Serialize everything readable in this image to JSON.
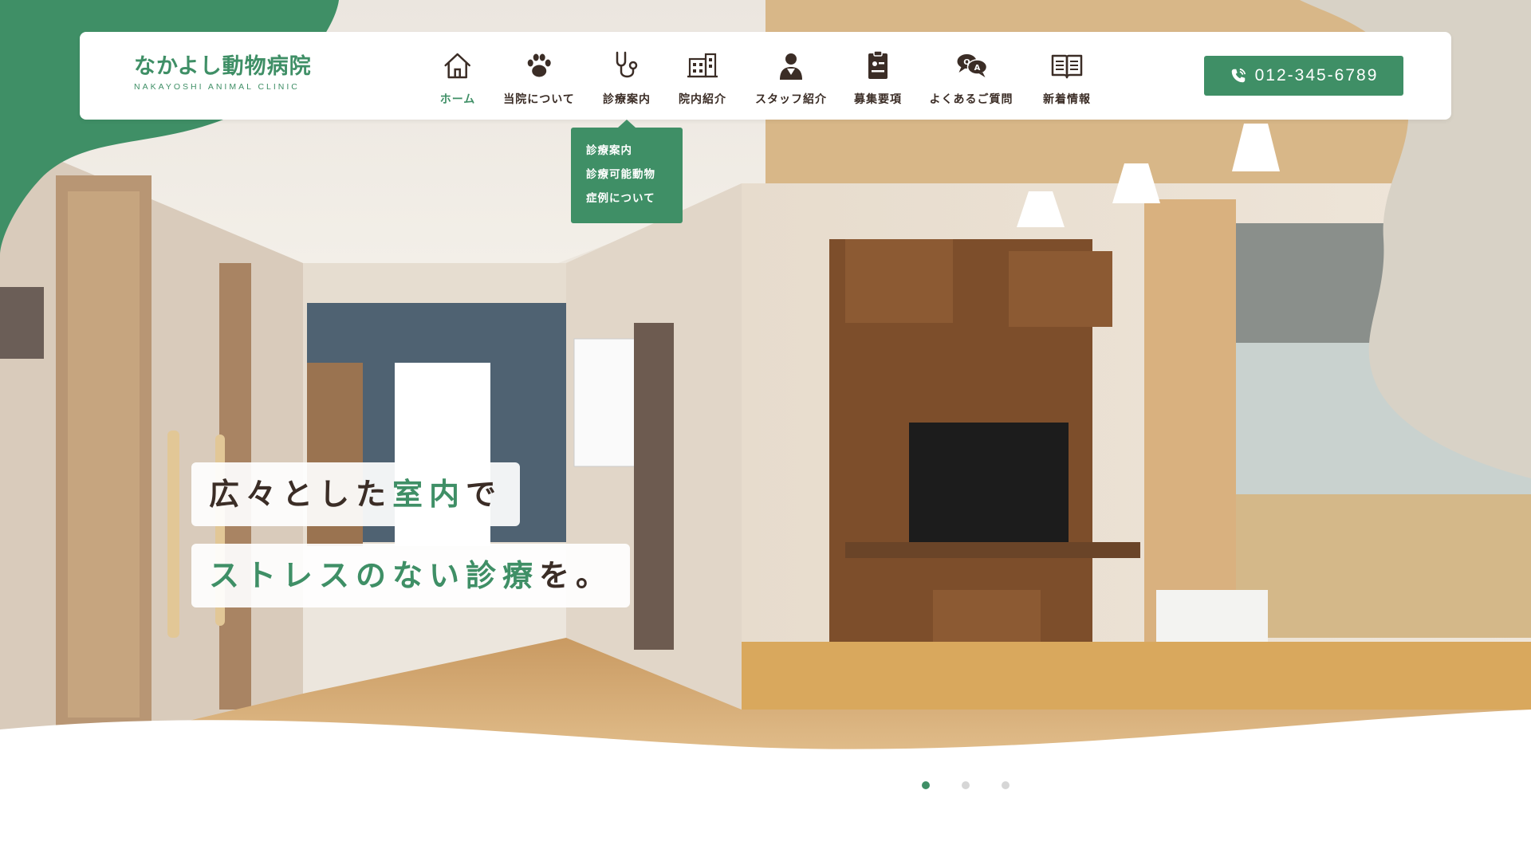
{
  "brand": {
    "name_ja": "なかよし動物病院",
    "name_en": "NAKAYOSHI ANIMAL CLINIC"
  },
  "nav": [
    {
      "label": "ホーム",
      "icon": "home-icon",
      "active": true
    },
    {
      "label": "当院について",
      "icon": "paw-icon",
      "active": false
    },
    {
      "label": "診療案内",
      "icon": "stethoscope-icon",
      "active": false
    },
    {
      "label": "院内紹介",
      "icon": "building-icon",
      "active": false
    },
    {
      "label": "スタッフ紹介",
      "icon": "doctor-icon",
      "active": false
    },
    {
      "label": "募集要項",
      "icon": "clipboard-icon",
      "active": false
    },
    {
      "label": "よくあるご質問",
      "icon": "qa-bubble-icon",
      "active": false
    },
    {
      "label": "新着情報",
      "icon": "open-book-icon",
      "active": false
    }
  ],
  "phone": {
    "number": "012-345-6789",
    "icon": "phone-icon"
  },
  "dropdown": {
    "items": [
      "診療案内",
      "診療可能動物",
      "症例について"
    ]
  },
  "hero": {
    "line1_a": "広々とした",
    "line1_b": "室内",
    "line1_c": "で",
    "line2_a": "ストレスのない",
    "line2_b": "診療",
    "line2_c": "を。"
  },
  "slider": {
    "count": 3,
    "active": 1
  },
  "colors": {
    "brand_green": "#3f8f66",
    "text_brown": "#3b2d26",
    "beige_blob": "#d8d2c6",
    "dot_inactive": "#d6d6d6"
  }
}
